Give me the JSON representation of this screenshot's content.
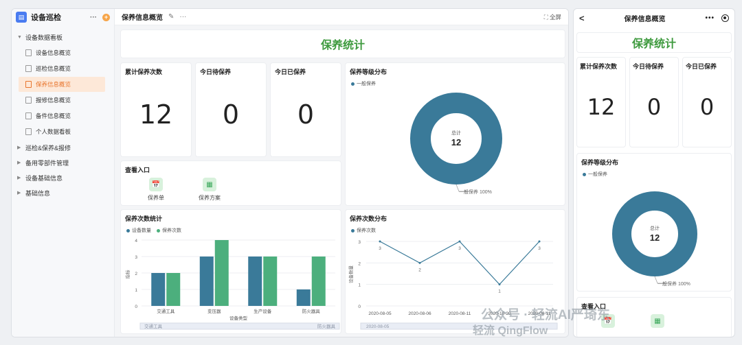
{
  "sidebar": {
    "app_title": "设备巡检",
    "more": "···",
    "plus": "+",
    "groups": [
      {
        "label": "设备数据看板",
        "arrow": "▼"
      },
      {
        "label": "巡检&保养&报修",
        "arrow": "▶"
      },
      {
        "label": "备用零部件管理",
        "arrow": "▶"
      },
      {
        "label": "设备基础信息",
        "arrow": "▶"
      },
      {
        "label": "基础信息",
        "arrow": "▶"
      }
    ],
    "items": [
      {
        "label": "设备信息概览"
      },
      {
        "label": "巡检信息概览"
      },
      {
        "label": "保养信息概览"
      },
      {
        "label": "报修信息概览"
      },
      {
        "label": "备件信息概览"
      },
      {
        "label": "个人数据看板"
      }
    ]
  },
  "topbar": {
    "title": "保养信息概览",
    "edit_icon": "✎",
    "more": "···",
    "fullscreen": "⛶ 全屏"
  },
  "dashboard": {
    "title": "保养统计",
    "stats": [
      {
        "label": "累计保养次数",
        "value": "12"
      },
      {
        "label": "今日待保养",
        "value": "0"
      },
      {
        "label": "今日已保养",
        "value": "0"
      }
    ],
    "entry": {
      "title": "查看入口",
      "items": [
        {
          "label": "保养单",
          "icon": "📅"
        },
        {
          "label": "保养方案",
          "icon": "▦"
        }
      ]
    }
  },
  "phone": {
    "back": "<",
    "title": "保养信息概览",
    "more": "•••",
    "heading": "保养统计",
    "stats": [
      {
        "label": "累计保养次数",
        "value": "12"
      },
      {
        "label": "今日待保养",
        "value": "0"
      },
      {
        "label": "今日已保养",
        "value": "0"
      }
    ],
    "donut_title": "保养等级分布",
    "entry_title": "查看入口"
  },
  "watermark": {
    "line1": "公众号 · 轻流AI严琦东",
    "line2": "轻流 QingFlow"
  },
  "colors": {
    "teal": "#3a7a99",
    "green": "#4caf7d",
    "title_green": "#3e9a3e",
    "active": "#e8742c"
  },
  "chart_data": [
    {
      "type": "pie",
      "title": "保养等级分布",
      "legend": [
        "一般保养"
      ],
      "slices": [
        {
          "name": "一般保养",
          "value": 12,
          "percent": 100
        }
      ],
      "center_label": "总计",
      "center_value": "12",
      "slice_label": "一般保养 100%"
    },
    {
      "type": "bar",
      "title": "保养次数统计",
      "categories": [
        "交通工具",
        "变压器",
        "生产设备",
        "防火器具"
      ],
      "series": [
        {
          "name": "设备数量",
          "values": [
            2,
            3,
            3,
            1
          ]
        },
        {
          "name": "保养次数",
          "values": [
            2,
            4,
            3,
            3
          ]
        }
      ],
      "xlabel": "设备类型",
      "ylabel": "指标",
      "ylim": [
        0,
        4
      ],
      "yticks": [
        "0",
        "1",
        "2",
        "3",
        "4"
      ],
      "slider_labels": [
        "交通工具",
        "防火器具"
      ]
    },
    {
      "type": "line",
      "title": "保养次数分布",
      "x": [
        "2020-08-05",
        "2020-08-06",
        "2020-08-11",
        "2020-10-20",
        "2020-08-11"
      ],
      "xticks": [
        "2020-08-05",
        "2020-08-06",
        "2020-08-11",
        "2020-10-20",
        "2020-08-11"
      ],
      "series": [
        {
          "name": "保养次数",
          "values": [
            3,
            2,
            3,
            1,
            3
          ]
        }
      ],
      "ylabel": "设备数量",
      "ylim": [
        0,
        3
      ],
      "yticks": [
        "0",
        "1",
        "2",
        "3"
      ],
      "slider_labels": [
        "2020-08-05"
      ]
    }
  ]
}
